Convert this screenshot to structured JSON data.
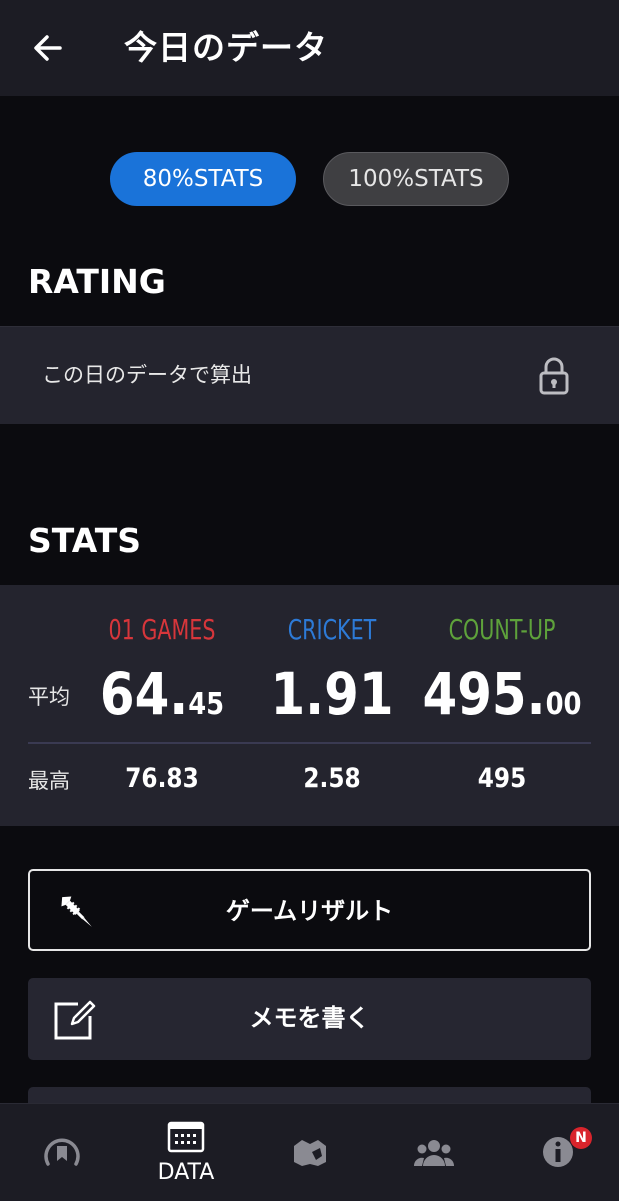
{
  "header": {
    "title": "今日のデータ"
  },
  "toggle": {
    "active": "80%STATS",
    "inactive": "100%STATS"
  },
  "rating": {
    "heading": "RATING",
    "row_label": "この日のデータで算出",
    "icon": "lock-icon"
  },
  "stats": {
    "heading": "STATS",
    "columns": [
      {
        "label": "01 GAMES",
        "color": "#d7363b"
      },
      {
        "label": "CRICKET",
        "color": "#2d7ad6"
      },
      {
        "label": "COUNT-UP",
        "color": "#5ea23b"
      }
    ],
    "avg_label": "平均",
    "avg": [
      {
        "int": "64.",
        "dec": "45"
      },
      {
        "int": "1.91",
        "dec": ""
      },
      {
        "int": "495.",
        "dec": "00"
      }
    ],
    "best_label": "最高",
    "best": [
      "76.83",
      "2.58",
      "495"
    ]
  },
  "buttons": {
    "game_result": "ゲームリザルト",
    "write_memo": "メモを書く"
  },
  "nav": {
    "items": [
      {
        "icon": "home-gauge-icon",
        "label": ""
      },
      {
        "icon": "calendar-grid-icon",
        "label": "DATA"
      },
      {
        "icon": "shop-icon",
        "label": ""
      },
      {
        "icon": "friends-icon",
        "label": ""
      },
      {
        "icon": "info-icon",
        "label": ""
      }
    ],
    "badge": "N"
  }
}
